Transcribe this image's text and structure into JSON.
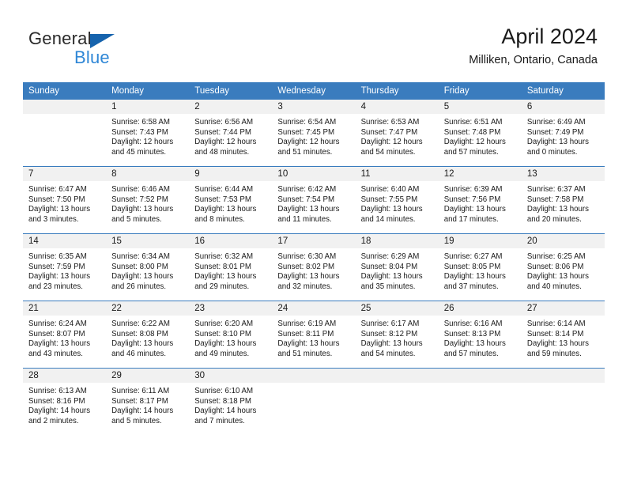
{
  "brand": {
    "name_part1": "General",
    "name_part2": "Blue",
    "triangle_color": "#1663ad",
    "blue_color": "#2f87d6"
  },
  "header": {
    "title": "April 2024",
    "subtitle": "Milliken, Ontario, Canada"
  },
  "theme": {
    "header_bar_color": "#3a7cbe",
    "daynum_bg": "#f1f1f1",
    "divider_color": "#3a7cbe"
  },
  "weekday_headers": [
    "Sunday",
    "Monday",
    "Tuesday",
    "Wednesday",
    "Thursday",
    "Friday",
    "Saturday"
  ],
  "weeks": [
    [
      {
        "day": "",
        "sunrise": "",
        "sunset": "",
        "daylight_line1": "",
        "daylight_line2": ""
      },
      {
        "day": "1",
        "sunrise": "Sunrise: 6:58 AM",
        "sunset": "Sunset: 7:43 PM",
        "daylight_line1": "Daylight: 12 hours",
        "daylight_line2": "and 45 minutes."
      },
      {
        "day": "2",
        "sunrise": "Sunrise: 6:56 AM",
        "sunset": "Sunset: 7:44 PM",
        "daylight_line1": "Daylight: 12 hours",
        "daylight_line2": "and 48 minutes."
      },
      {
        "day": "3",
        "sunrise": "Sunrise: 6:54 AM",
        "sunset": "Sunset: 7:45 PM",
        "daylight_line1": "Daylight: 12 hours",
        "daylight_line2": "and 51 minutes."
      },
      {
        "day": "4",
        "sunrise": "Sunrise: 6:53 AM",
        "sunset": "Sunset: 7:47 PM",
        "daylight_line1": "Daylight: 12 hours",
        "daylight_line2": "and 54 minutes."
      },
      {
        "day": "5",
        "sunrise": "Sunrise: 6:51 AM",
        "sunset": "Sunset: 7:48 PM",
        "daylight_line1": "Daylight: 12 hours",
        "daylight_line2": "and 57 minutes."
      },
      {
        "day": "6",
        "sunrise": "Sunrise: 6:49 AM",
        "sunset": "Sunset: 7:49 PM",
        "daylight_line1": "Daylight: 13 hours",
        "daylight_line2": "and 0 minutes."
      }
    ],
    [
      {
        "day": "7",
        "sunrise": "Sunrise: 6:47 AM",
        "sunset": "Sunset: 7:50 PM",
        "daylight_line1": "Daylight: 13 hours",
        "daylight_line2": "and 3 minutes."
      },
      {
        "day": "8",
        "sunrise": "Sunrise: 6:46 AM",
        "sunset": "Sunset: 7:52 PM",
        "daylight_line1": "Daylight: 13 hours",
        "daylight_line2": "and 5 minutes."
      },
      {
        "day": "9",
        "sunrise": "Sunrise: 6:44 AM",
        "sunset": "Sunset: 7:53 PM",
        "daylight_line1": "Daylight: 13 hours",
        "daylight_line2": "and 8 minutes."
      },
      {
        "day": "10",
        "sunrise": "Sunrise: 6:42 AM",
        "sunset": "Sunset: 7:54 PM",
        "daylight_line1": "Daylight: 13 hours",
        "daylight_line2": "and 11 minutes."
      },
      {
        "day": "11",
        "sunrise": "Sunrise: 6:40 AM",
        "sunset": "Sunset: 7:55 PM",
        "daylight_line1": "Daylight: 13 hours",
        "daylight_line2": "and 14 minutes."
      },
      {
        "day": "12",
        "sunrise": "Sunrise: 6:39 AM",
        "sunset": "Sunset: 7:56 PM",
        "daylight_line1": "Daylight: 13 hours",
        "daylight_line2": "and 17 minutes."
      },
      {
        "day": "13",
        "sunrise": "Sunrise: 6:37 AM",
        "sunset": "Sunset: 7:58 PM",
        "daylight_line1": "Daylight: 13 hours",
        "daylight_line2": "and 20 minutes."
      }
    ],
    [
      {
        "day": "14",
        "sunrise": "Sunrise: 6:35 AM",
        "sunset": "Sunset: 7:59 PM",
        "daylight_line1": "Daylight: 13 hours",
        "daylight_line2": "and 23 minutes."
      },
      {
        "day": "15",
        "sunrise": "Sunrise: 6:34 AM",
        "sunset": "Sunset: 8:00 PM",
        "daylight_line1": "Daylight: 13 hours",
        "daylight_line2": "and 26 minutes."
      },
      {
        "day": "16",
        "sunrise": "Sunrise: 6:32 AM",
        "sunset": "Sunset: 8:01 PM",
        "daylight_line1": "Daylight: 13 hours",
        "daylight_line2": "and 29 minutes."
      },
      {
        "day": "17",
        "sunrise": "Sunrise: 6:30 AM",
        "sunset": "Sunset: 8:02 PM",
        "daylight_line1": "Daylight: 13 hours",
        "daylight_line2": "and 32 minutes."
      },
      {
        "day": "18",
        "sunrise": "Sunrise: 6:29 AM",
        "sunset": "Sunset: 8:04 PM",
        "daylight_line1": "Daylight: 13 hours",
        "daylight_line2": "and 35 minutes."
      },
      {
        "day": "19",
        "sunrise": "Sunrise: 6:27 AM",
        "sunset": "Sunset: 8:05 PM",
        "daylight_line1": "Daylight: 13 hours",
        "daylight_line2": "and 37 minutes."
      },
      {
        "day": "20",
        "sunrise": "Sunrise: 6:25 AM",
        "sunset": "Sunset: 8:06 PM",
        "daylight_line1": "Daylight: 13 hours",
        "daylight_line2": "and 40 minutes."
      }
    ],
    [
      {
        "day": "21",
        "sunrise": "Sunrise: 6:24 AM",
        "sunset": "Sunset: 8:07 PM",
        "daylight_line1": "Daylight: 13 hours",
        "daylight_line2": "and 43 minutes."
      },
      {
        "day": "22",
        "sunrise": "Sunrise: 6:22 AM",
        "sunset": "Sunset: 8:08 PM",
        "daylight_line1": "Daylight: 13 hours",
        "daylight_line2": "and 46 minutes."
      },
      {
        "day": "23",
        "sunrise": "Sunrise: 6:20 AM",
        "sunset": "Sunset: 8:10 PM",
        "daylight_line1": "Daylight: 13 hours",
        "daylight_line2": "and 49 minutes."
      },
      {
        "day": "24",
        "sunrise": "Sunrise: 6:19 AM",
        "sunset": "Sunset: 8:11 PM",
        "daylight_line1": "Daylight: 13 hours",
        "daylight_line2": "and 51 minutes."
      },
      {
        "day": "25",
        "sunrise": "Sunrise: 6:17 AM",
        "sunset": "Sunset: 8:12 PM",
        "daylight_line1": "Daylight: 13 hours",
        "daylight_line2": "and 54 minutes."
      },
      {
        "day": "26",
        "sunrise": "Sunrise: 6:16 AM",
        "sunset": "Sunset: 8:13 PM",
        "daylight_line1": "Daylight: 13 hours",
        "daylight_line2": "and 57 minutes."
      },
      {
        "day": "27",
        "sunrise": "Sunrise: 6:14 AM",
        "sunset": "Sunset: 8:14 PM",
        "daylight_line1": "Daylight: 13 hours",
        "daylight_line2": "and 59 minutes."
      }
    ],
    [
      {
        "day": "28",
        "sunrise": "Sunrise: 6:13 AM",
        "sunset": "Sunset: 8:16 PM",
        "daylight_line1": "Daylight: 14 hours",
        "daylight_line2": "and 2 minutes."
      },
      {
        "day": "29",
        "sunrise": "Sunrise: 6:11 AM",
        "sunset": "Sunset: 8:17 PM",
        "daylight_line1": "Daylight: 14 hours",
        "daylight_line2": "and 5 minutes."
      },
      {
        "day": "30",
        "sunrise": "Sunrise: 6:10 AM",
        "sunset": "Sunset: 8:18 PM",
        "daylight_line1": "Daylight: 14 hours",
        "daylight_line2": "and 7 minutes."
      },
      {
        "day": "",
        "sunrise": "",
        "sunset": "",
        "daylight_line1": "",
        "daylight_line2": ""
      },
      {
        "day": "",
        "sunrise": "",
        "sunset": "",
        "daylight_line1": "",
        "daylight_line2": ""
      },
      {
        "day": "",
        "sunrise": "",
        "sunset": "",
        "daylight_line1": "",
        "daylight_line2": ""
      },
      {
        "day": "",
        "sunrise": "",
        "sunset": "",
        "daylight_line1": "",
        "daylight_line2": ""
      }
    ]
  ]
}
